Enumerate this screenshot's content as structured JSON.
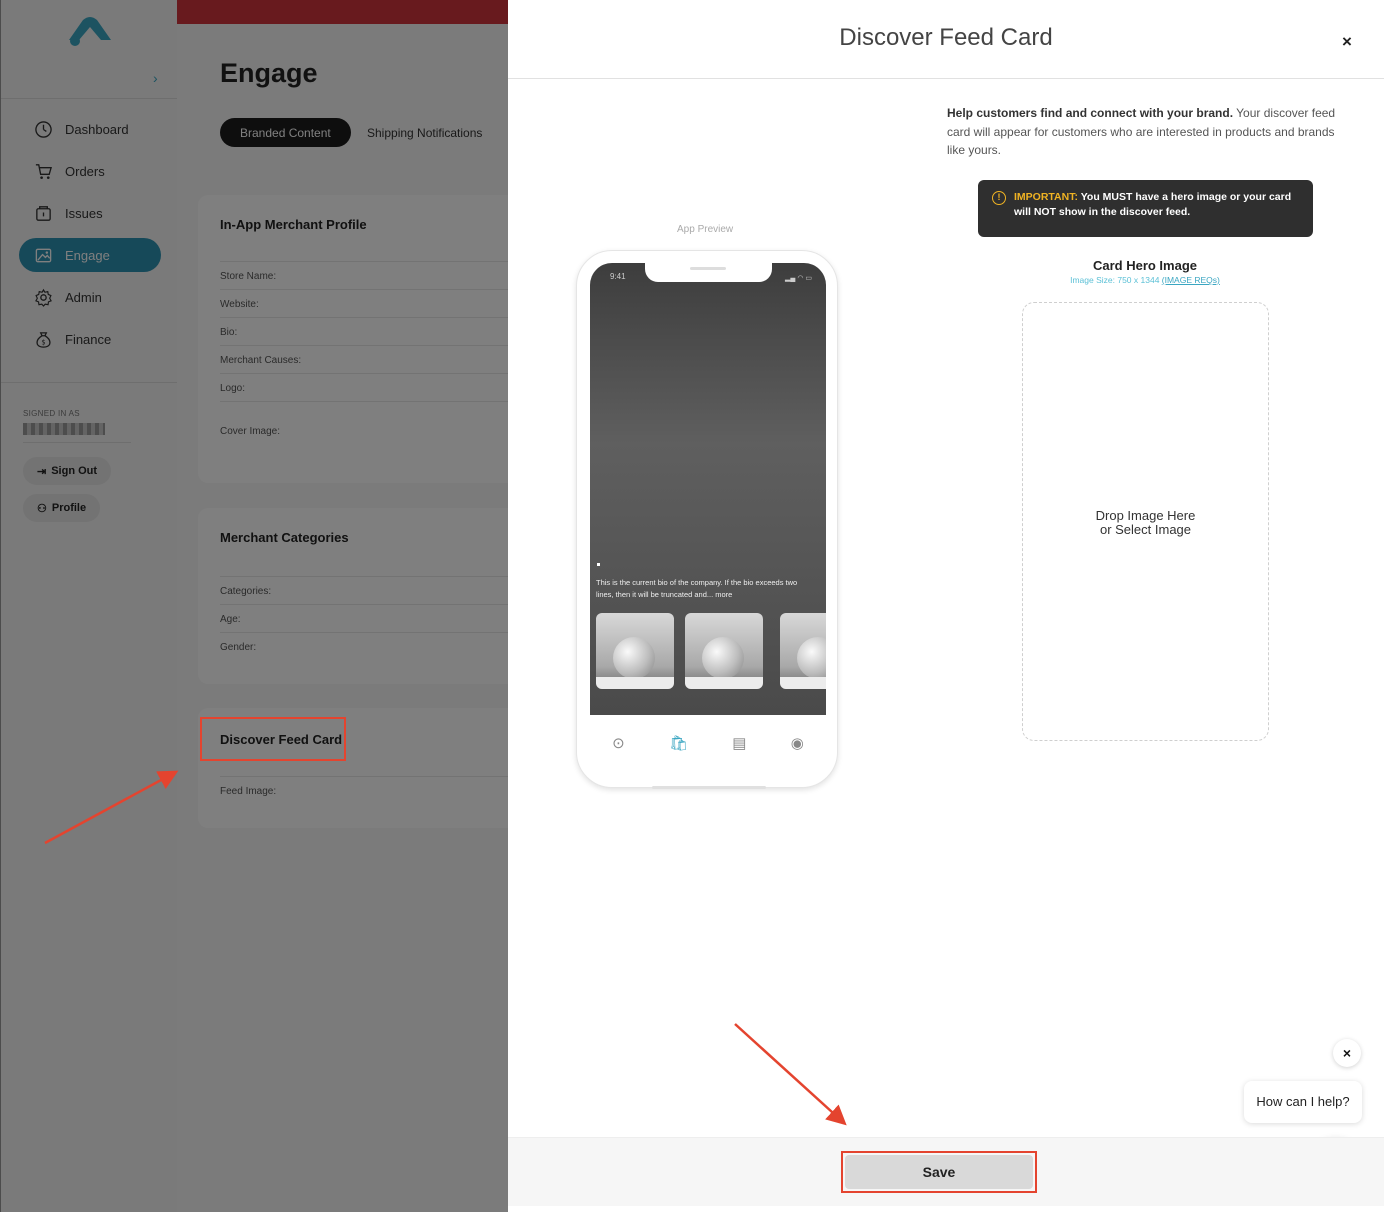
{
  "sidebar": {
    "items": [
      {
        "label": "Dashboard",
        "icon": "dashboard-icon"
      },
      {
        "label": "Orders",
        "icon": "cart-icon"
      },
      {
        "label": "Issues",
        "icon": "issues-icon"
      },
      {
        "label": "Engage",
        "icon": "image-icon",
        "active": true
      },
      {
        "label": "Admin",
        "icon": "gear-icon"
      },
      {
        "label": "Finance",
        "icon": "moneybag-icon"
      }
    ],
    "signed_in_label": "SIGNED IN AS",
    "sign_out": "Sign Out",
    "profile": "Profile"
  },
  "main": {
    "title": "Engage",
    "tabs": [
      "Branded Content",
      "Shipping Notifications"
    ],
    "profile_card": {
      "title": "In-App Merchant Profile",
      "fields": [
        "Store Name:",
        "Website:",
        "Bio:",
        "Merchant Causes:",
        "Logo:",
        "Cover Image:"
      ]
    },
    "categories_card": {
      "title": "Merchant Categories",
      "fields": [
        "Categories:",
        "Age:",
        "Gender:"
      ]
    },
    "feed_card": {
      "title": "Discover Feed Card",
      "fields": [
        "Feed Image:"
      ]
    }
  },
  "modal": {
    "title": "Discover Feed Card",
    "close": "×",
    "preview_label": "App Preview",
    "phone": {
      "time": "9:41",
      "bio": "This is the current bio of the company. If the bio exceeds two lines, then it will be truncated and... more"
    },
    "help_bold": "Help customers find and connect with your brand.",
    "help_text": " Your discover feed card will appear for customers who are interested in products and brands like yours.",
    "important_keyword": "IMPORTANT:",
    "important_text": " You MUST have a hero image or your card will NOT show in the discover feed.",
    "hero_title": "Card Hero Image",
    "hero_size": "Image Size: 750 x 1344 ",
    "hero_reqs": "(IMAGE REQs)",
    "drop_line1": "Drop Image Here",
    "drop_line2": "or Select Image",
    "save_label": "Save"
  },
  "chat": {
    "close": "×",
    "prompt": "How can I help?"
  },
  "colors": {
    "accent": "#2d93b3",
    "annotation": "#e4442f",
    "warning": "#f0b323",
    "brand_red": "#d1343d"
  }
}
